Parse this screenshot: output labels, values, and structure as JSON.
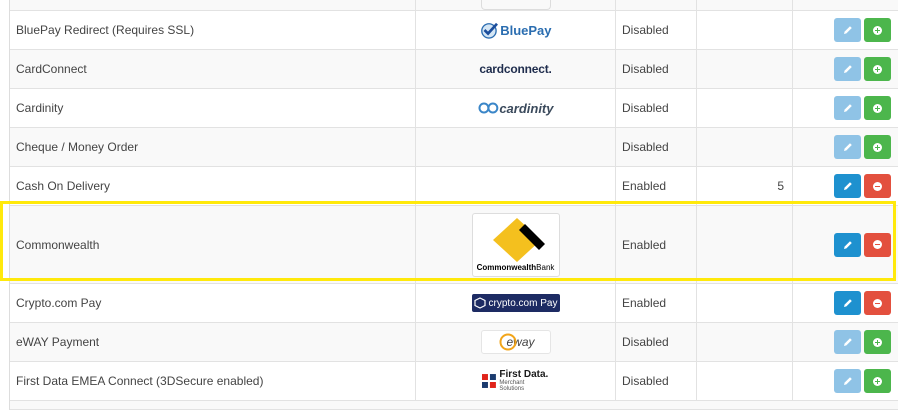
{
  "rows": [
    {
      "name": "",
      "status": "",
      "sort": "",
      "logo": "partial"
    },
    {
      "name": "BluePay Redirect (Requires SSL)",
      "status": "Disabled",
      "sort": "",
      "logo_text": "BluePay"
    },
    {
      "name": "CardConnect",
      "status": "Disabled",
      "sort": "",
      "logo_text": "cardconnect."
    },
    {
      "name": "Cardinity",
      "status": "Disabled",
      "sort": "",
      "logo_text": "cardinity"
    },
    {
      "name": "Cheque / Money Order",
      "status": "Disabled",
      "sort": ""
    },
    {
      "name": "Cash On Delivery",
      "status": "Enabled",
      "sort": "5"
    },
    {
      "name": "Commonwealth",
      "status": "Enabled",
      "sort": "",
      "logo_text_bold": "Commonwealth",
      "logo_text_light": "Bank"
    },
    {
      "name": "Crypto.com Pay",
      "status": "Enabled",
      "sort": "",
      "logo_text": "crypto.com Pay"
    },
    {
      "name": "eWAY Payment",
      "status": "Disabled",
      "sort": "",
      "logo_text": "eway"
    },
    {
      "name": "First Data EMEA Connect (3DSecure enabled)",
      "status": "Disabled",
      "sort": "",
      "logo_text": "First Data.",
      "logo_subtext": "Merchant Solutions"
    }
  ],
  "colors": {
    "edit": "#1e91cf",
    "edit_disabled": "#8fc3e6",
    "install": "#4cb64c",
    "uninstall": "#e3503e",
    "highlight": "#ffe90b"
  },
  "icons": {
    "edit": "pencil-icon",
    "install": "plus-circle-icon",
    "uninstall": "minus-circle-icon"
  }
}
